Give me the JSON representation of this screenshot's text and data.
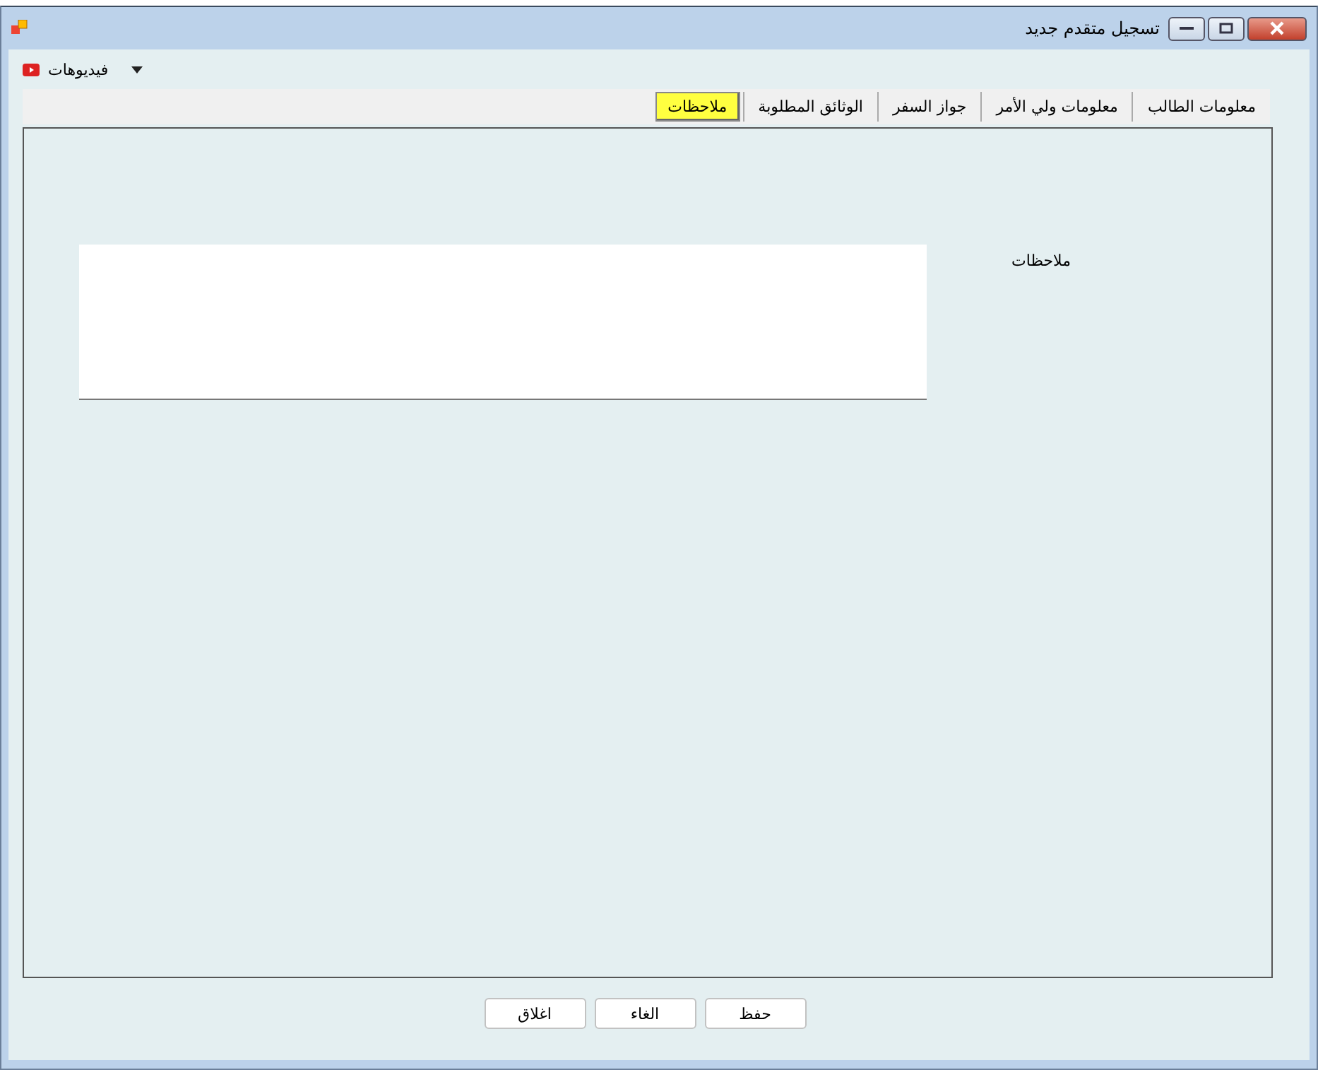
{
  "window": {
    "title": "تسجيل متقدم جديد"
  },
  "menu": {
    "label": "فيديوهات"
  },
  "tabs": [
    {
      "label": "معلومات الطالب",
      "selected": false
    },
    {
      "label": "معلومات ولي الأمر",
      "selected": false
    },
    {
      "label": "جواز السفر",
      "selected": false
    },
    {
      "label": "الوثائق المطلوبة",
      "selected": false
    },
    {
      "label": "ملاحظات",
      "selected": true
    }
  ],
  "notes": {
    "label": "ملاحظات"
  },
  "buttons": [
    "حفظ",
    "الغاء",
    "اغلاق"
  ]
}
